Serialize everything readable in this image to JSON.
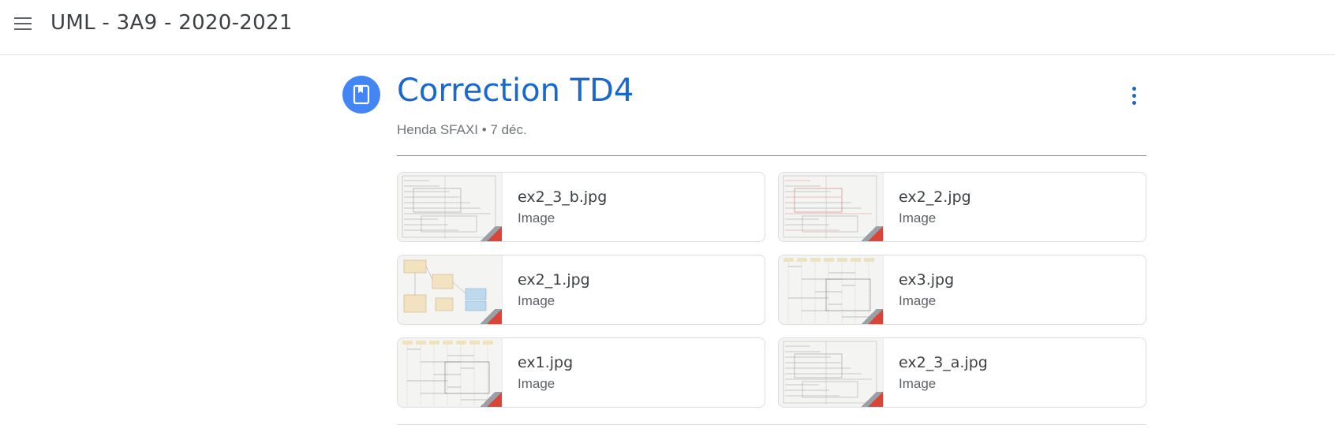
{
  "header": {
    "menu_icon": "hamburger-menu-icon",
    "class_title": "UML - 3A9 - 2020-2021"
  },
  "post": {
    "icon": "book-icon",
    "title": "Correction TD4",
    "meta": "Henda SFAXI • 7 déc.",
    "more_icon": "more-vert-icon",
    "accent_color": "#1967d2",
    "icon_bg": "#4285f4"
  },
  "attachments": [
    {
      "name": "ex2_3_b.jpg",
      "type": "Image",
      "thumb_style": "diagram"
    },
    {
      "name": "ex2_2.jpg",
      "type": "Image",
      "thumb_style": "diagram-red"
    },
    {
      "name": "ex2_1.jpg",
      "type": "Image",
      "thumb_style": "class-diagram"
    },
    {
      "name": "ex3.jpg",
      "type": "Image",
      "thumb_style": "sequence"
    },
    {
      "name": "ex1.jpg",
      "type": "Image",
      "thumb_style": "sequence"
    },
    {
      "name": "ex2_3_a.jpg",
      "type": "Image",
      "thumb_style": "diagram"
    }
  ],
  "file_badge_color": "#db4437"
}
